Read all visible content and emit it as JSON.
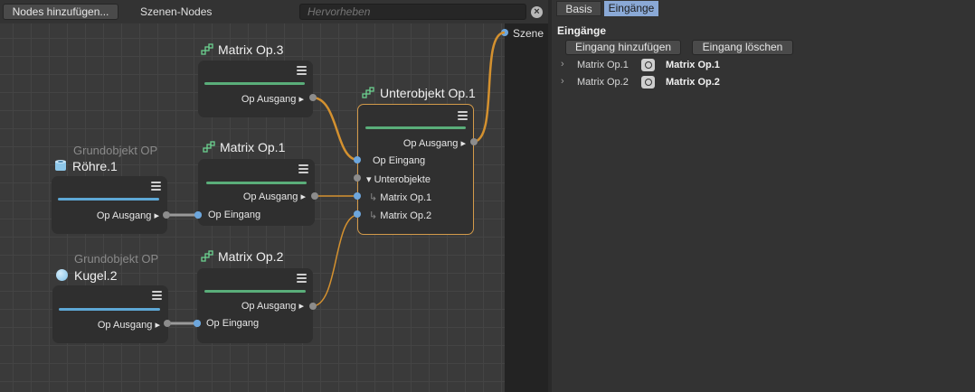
{
  "editor": {
    "add_nodes_button": "Nodes hinzufügen...",
    "scene_nodes_label": "Szenen-Nodes",
    "highlight_placeholder": "Hervorheben",
    "scene_label": "Szene"
  },
  "nodes": {
    "matrix3": {
      "title": "Matrix Op.3",
      "out": "Op Ausgang"
    },
    "matrix1": {
      "title": "Matrix Op.1",
      "out": "Op Ausgang",
      "in": "Op Eingang"
    },
    "matrix2": {
      "title": "Matrix Op.2",
      "out": "Op Ausgang",
      "in": "Op Eingang"
    },
    "roehre": {
      "subtitle": "Grundobjekt OP",
      "title": "Röhre.1",
      "out": "Op Ausgang"
    },
    "kugel": {
      "subtitle": "Grundobjekt OP",
      "title": "Kugel.2",
      "out": "Op Ausgang"
    },
    "unterobjekt": {
      "title": "Unterobjekt Op.1",
      "out": "Op Ausgang",
      "in": "Op Eingang",
      "group": "Unterobjekte",
      "child1": "Matrix Op.1",
      "child2": "Matrix Op.2"
    }
  },
  "colors": {
    "wire_orange": "#d4912f",
    "bar_green": "#5aae7a",
    "bar_blue": "#5ea8d6",
    "port_blue": "#6da6dc",
    "tab_active": "#8aa9d6"
  },
  "panel": {
    "tabs": [
      "Basis",
      "Eingänge"
    ],
    "active_tab": "Eingänge",
    "section_title": "Eingänge",
    "add_input_button": "Eingang hinzufügen",
    "delete_input_button": "Eingang löschen",
    "inputs": [
      {
        "name": "Matrix Op.1",
        "value": "Matrix Op.1"
      },
      {
        "name": "Matrix Op.2",
        "value": "Matrix Op.2"
      }
    ]
  }
}
